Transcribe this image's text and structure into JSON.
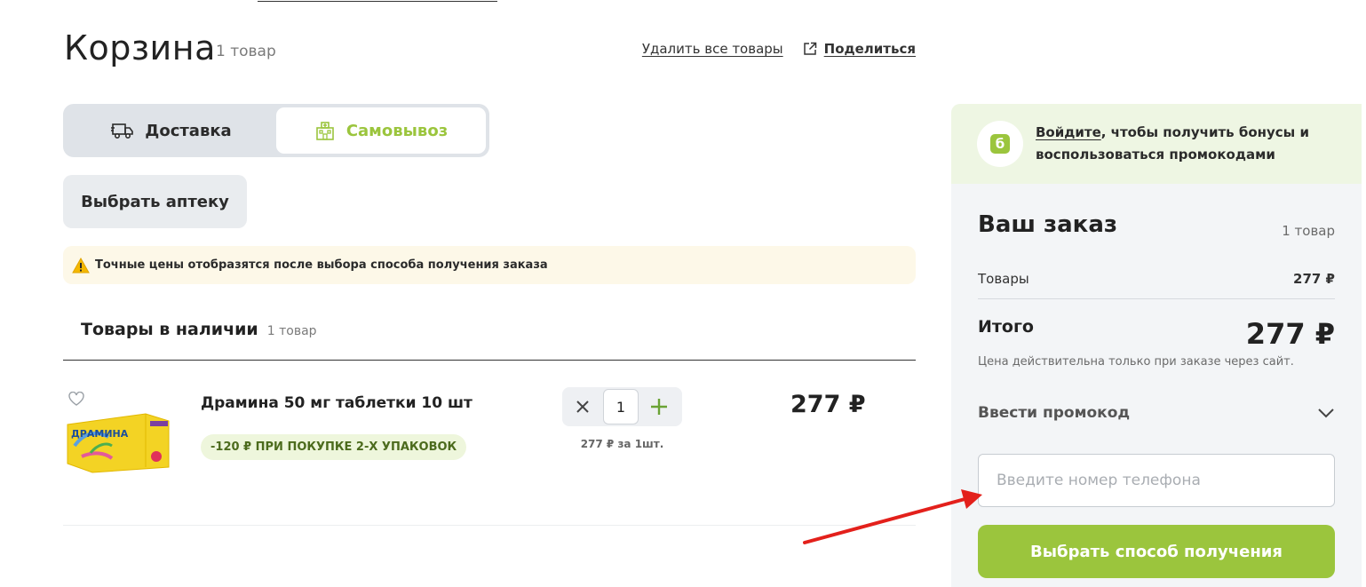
{
  "header": {
    "title": "Корзина",
    "count": "1 товар",
    "delete_all": "Удалить все товары",
    "share": "Поделиться"
  },
  "tabs": [
    {
      "label": "Доставка",
      "active": false,
      "icon": "truck-icon"
    },
    {
      "label": "Самовывоз",
      "active": true,
      "icon": "pharmacy-building-icon"
    }
  ],
  "choose_pharmacy_label": "Выбрать аптеку",
  "notice": {
    "text": "Точные цены отобразятся после выбора способа получения заказа",
    "icon": "warning-icon"
  },
  "in_stock": {
    "title": "Товары в наличии",
    "count": "1 товар"
  },
  "items": [
    {
      "name": "Драмина 50 мг таблетки 10 шт",
      "promo": "-120 ₽ ПРИ ПОКУПКЕ 2-Х УПАКОВОК",
      "quantity": "1",
      "unit_price": "277 ₽ за 1шт.",
      "price": "277 ₽",
      "image_text": "ДРАМИНА"
    }
  ],
  "sidebar": {
    "bonus_logo": "б",
    "bonus_link": "Войдите",
    "bonus_text": ", чтобы получить бонусы и",
    "bonus_text2": "воспользоваться промокодами",
    "order_title": "Ваш заказ",
    "order_count": "1 товар",
    "goods_label": "Товары",
    "goods_value": "277 ₽",
    "total_label": "Итого",
    "total_value": "277 ₽",
    "validity": "Цена действительна только при заказе через сайт.",
    "promo_label": "Ввести промокод",
    "phone_placeholder": "Введите номер телефона",
    "cta_label": "Выбрать способ получения"
  },
  "colors": {
    "accent": "#9bc53d",
    "annotation_arrow": "#e3201b"
  }
}
